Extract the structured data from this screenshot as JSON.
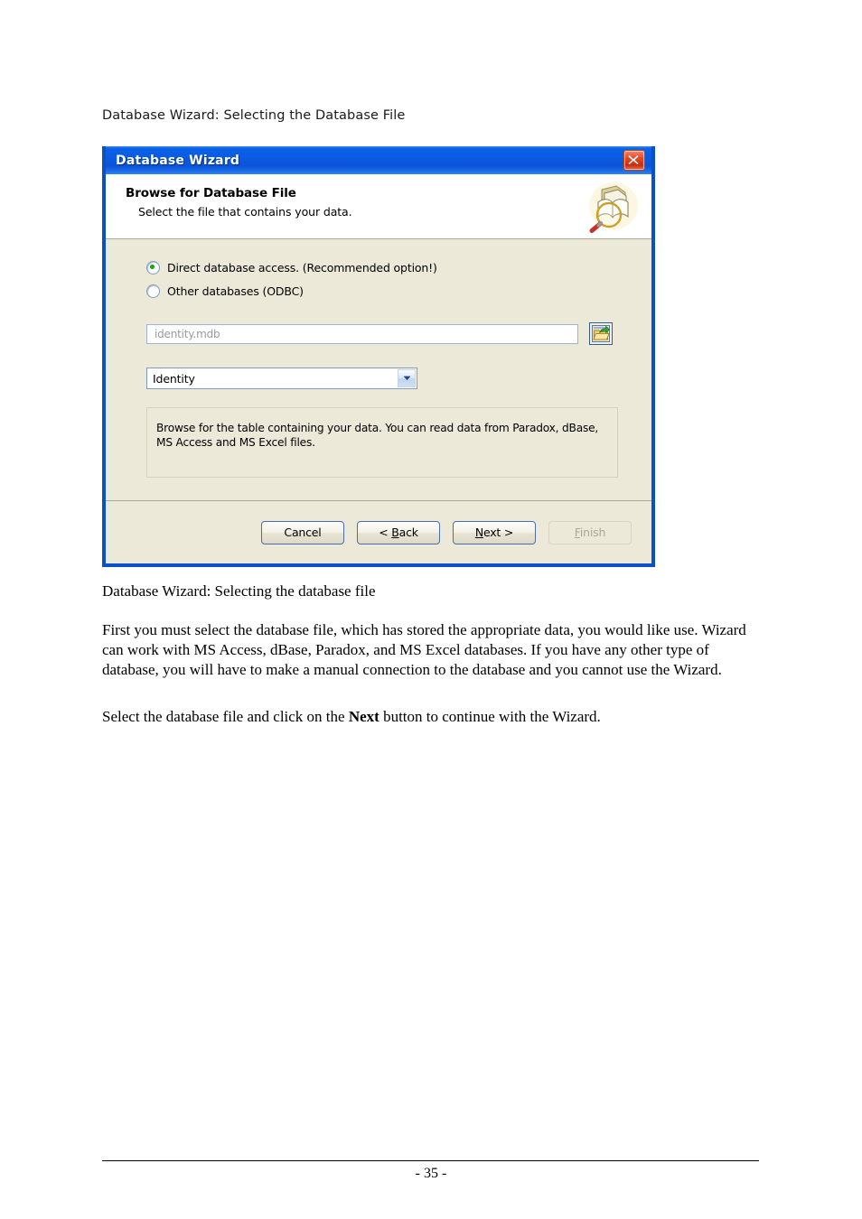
{
  "document": {
    "heading": "Database Wizard: Selecting the Database File",
    "caption": "Database Wizard: Selecting the database file",
    "paragraph1": "First you must select the database file, which has stored the appropriate data, you would like use. Wizard can work with MS Access, dBase, Paradox, and MS Excel databases. If you have any other type of database, you will have to make a manual connection to the database and you cannot use the Wizard.",
    "paragraph2_before": "Select the database file and click on the ",
    "paragraph2_bold": "Next",
    "paragraph2_after": " button to continue with the Wizard.",
    "page_number": "- 35 -"
  },
  "dialog": {
    "title": "Database Wizard",
    "close_icon": "close-icon",
    "header": {
      "title": "Browse for Database File",
      "subtitle": "Select the file that contains your data.",
      "icon": "books-magnifier-icon"
    },
    "options": [
      {
        "label": "Direct database access. (Recommended option!)",
        "selected": true
      },
      {
        "label": "Other databases (ODBC)",
        "selected": false
      }
    ],
    "file_field": {
      "value": "identity.mdb",
      "placeholder": "identity.mdb",
      "browse_icon": "open-folder-icon"
    },
    "table_combo": {
      "value": "Identity",
      "arrow_icon": "chevron-down-icon"
    },
    "info": "Browse for the table containing your data. You can read data from Paradox, dBase, MS Access and MS Excel files.",
    "buttons": [
      {
        "label": "Cancel",
        "mnemonic": "",
        "disabled": false
      },
      {
        "label": "< Back",
        "mnemonic": "B",
        "disabled": false
      },
      {
        "label": "Next >",
        "mnemonic": "N",
        "disabled": false
      },
      {
        "label": "Finish",
        "mnemonic": "F",
        "disabled": true
      }
    ]
  },
  "colors": {
    "titlebar_blue": "#0a5ae0",
    "dialog_face": "#ece9d8",
    "close_red": "#c92d10",
    "radio_green": "#1a9d1a"
  }
}
